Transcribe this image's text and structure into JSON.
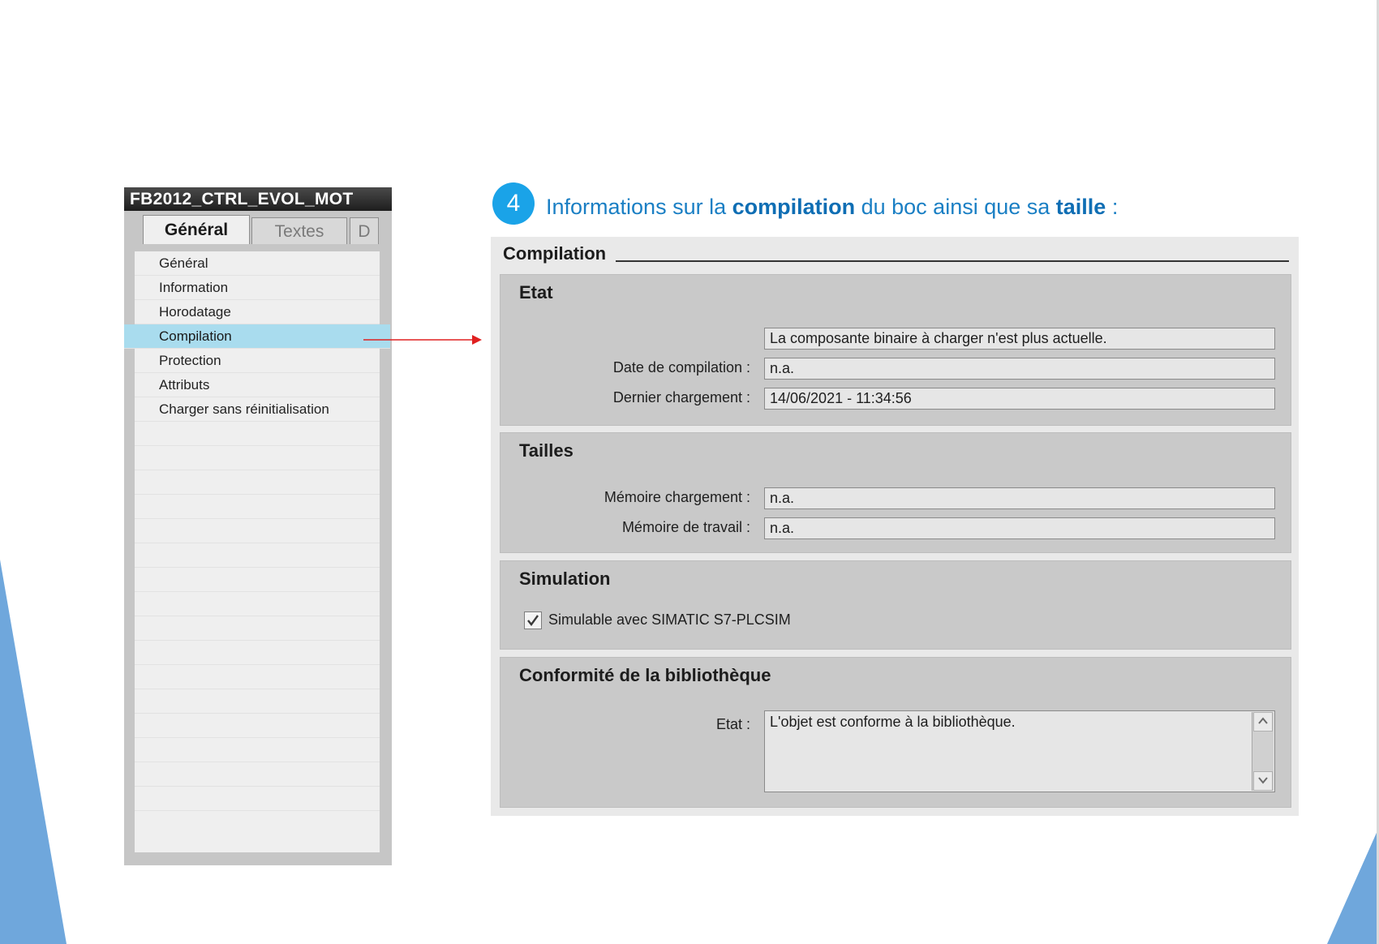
{
  "colors": {
    "accent": "#1aa3e8",
    "heading_text": "#1a7fc4",
    "selected_item": "#a9dcee",
    "arrow": "#e02020"
  },
  "properties_panel": {
    "title": "FB2012_CTRL_EVOL_MOT",
    "tabs": [
      {
        "label": "Général",
        "active": true
      },
      {
        "label": "Textes",
        "active": false
      },
      {
        "label": "D",
        "active": false
      }
    ],
    "items": [
      {
        "label": "Général"
      },
      {
        "label": "Information"
      },
      {
        "label": "Horodatage"
      },
      {
        "label": "Compilation",
        "selected": true
      },
      {
        "label": "Protection"
      },
      {
        "label": "Attributs"
      },
      {
        "label": "Charger sans réinitialisation"
      }
    ]
  },
  "step": {
    "number": "4",
    "text_before": "Informations sur la ",
    "bold1": "compilation",
    "text_middle": " du boc ainsi que sa ",
    "bold2": "taille",
    "text_after": " :"
  },
  "compilation": {
    "header": "Compilation",
    "etat": {
      "title": "Etat",
      "status_value": "La composante binaire à charger n'est plus actuelle.",
      "date_label": "Date de compilation :",
      "date_value": "n.a.",
      "last_load_label": "Dernier chargement :",
      "last_load_value": "14/06/2021 - 11:34:56"
    },
    "tailles": {
      "title": "Tailles",
      "load_memory_label": "Mémoire chargement :",
      "load_memory_value": "n.a.",
      "work_memory_label": "Mémoire de travail :",
      "work_memory_value": "n.a."
    },
    "simulation": {
      "title": "Simulation",
      "checkbox_label": "Simulable avec SIMATIC S7-PLCSIM",
      "checked": true
    },
    "library": {
      "title": "Conformité de la bibliothèque",
      "state_label": "Etat :",
      "state_value": "L'objet est conforme à la bibliothèque."
    }
  }
}
